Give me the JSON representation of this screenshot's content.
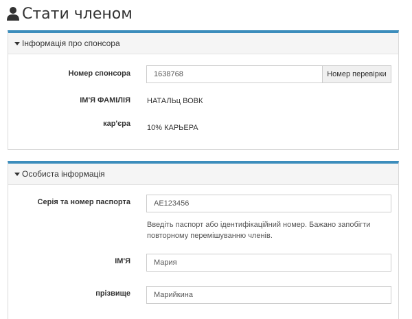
{
  "page": {
    "title": "Стати членом"
  },
  "sponsor_panel": {
    "header": "Інформація про спонсора",
    "sponsor_number_label": "Номер спонсора",
    "sponsor_number_value": "1638768",
    "check_button": "Номер перевірки",
    "name_label": "ІМ'Я ФАМІЛІЯ",
    "name_value": "НАТАЛЬц ВОВК",
    "career_label": "кар'єра",
    "career_value": "10% КАРЬЕРА"
  },
  "personal_panel": {
    "header": "Особиста інформація",
    "passport_label": "Серія та номер паспорта",
    "passport_placeholder": "AE123456",
    "passport_help": "Введіть паспорт або ідентифікаційний номер. Бажано запобігти повторному перемішуванню членів.",
    "first_name_label": "ІМ'Я",
    "first_name_placeholder": "Мария",
    "last_name_label": "прізвище",
    "last_name_placeholder": "Марийкина"
  }
}
